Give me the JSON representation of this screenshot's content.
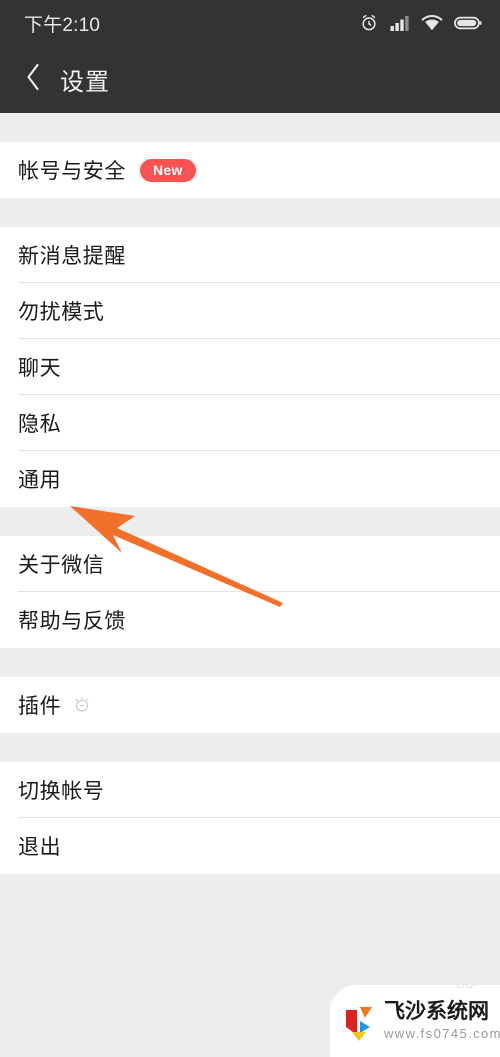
{
  "statusbar": {
    "time": "下午2:10",
    "icons": [
      "alarm-icon",
      "signal-icon",
      "wifi-icon",
      "battery-icon"
    ]
  },
  "header": {
    "back_icon": "back-chevron-icon",
    "title": "设置"
  },
  "sections": [
    {
      "id": "account",
      "rows": [
        {
          "label": "帐号与安全",
          "badge": "New"
        }
      ]
    },
    {
      "id": "preferences",
      "rows": [
        {
          "label": "新消息提醒"
        },
        {
          "label": "勿扰模式"
        },
        {
          "label": "聊天"
        },
        {
          "label": "隐私"
        },
        {
          "label": "通用"
        }
      ]
    },
    {
      "id": "info",
      "rows": [
        {
          "label": "关于微信"
        },
        {
          "label": "帮助与反馈"
        }
      ]
    },
    {
      "id": "plugins",
      "rows": [
        {
          "label": "插件",
          "icon": "plugin-badge-icon"
        }
      ]
    },
    {
      "id": "account-actions",
      "rows": [
        {
          "label": "切换帐号"
        },
        {
          "label": "退出"
        }
      ]
    }
  ],
  "annotation": {
    "arrow_color": "#F2702A",
    "points_at": "通用"
  },
  "watermark": {
    "title": "飞沙系统网",
    "url": "www.fs0745.com",
    "logo_colors": [
      "#E02020",
      "#F07818",
      "#2196E8",
      "#F5C518"
    ]
  },
  "colors": {
    "header_bg": "#333333",
    "page_bg": "#ededed",
    "row_bg": "#ffffff",
    "badge_red": "#fa5151",
    "divider": "#e3e3e3",
    "text_primary": "#1a1a1a"
  }
}
